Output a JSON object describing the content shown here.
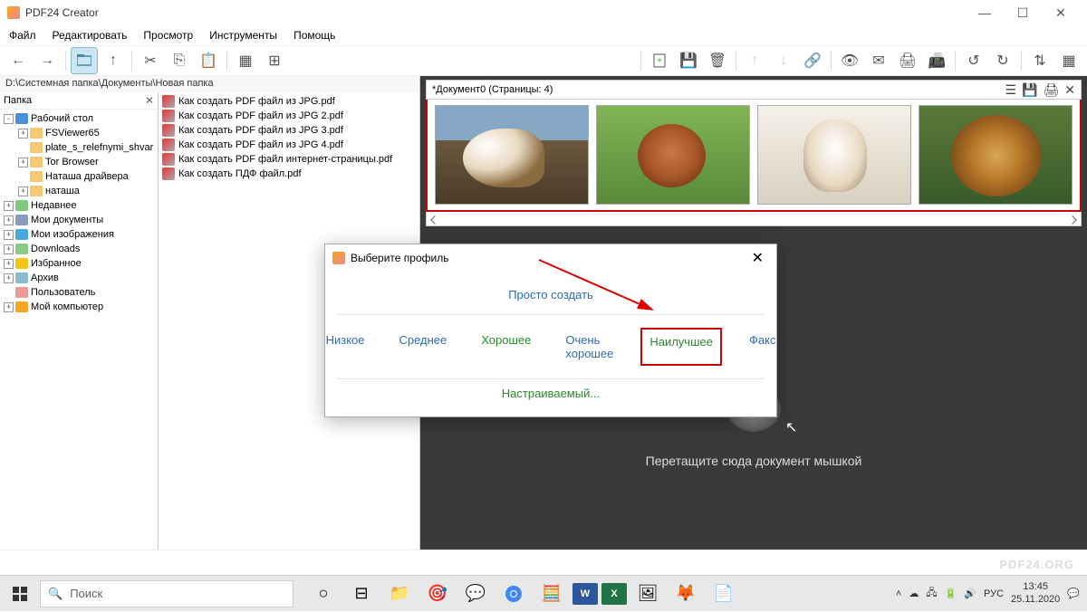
{
  "titlebar": {
    "app_name": "PDF24 Creator"
  },
  "menu": {
    "file": "Файл",
    "edit": "Редактировать",
    "view": "Просмотр",
    "tools": "Инструменты",
    "help": "Помощь"
  },
  "path": "D:\\Системная папка\\Документы\\Новая папка",
  "tree": {
    "header": "Папка",
    "items": [
      {
        "label": "Рабочий стол",
        "exp": "-",
        "ico": "desktop",
        "indent": 0
      },
      {
        "label": "FSViewer65",
        "exp": "+",
        "ico": "folder",
        "indent": 1
      },
      {
        "label": "plate_s_relefnymi_shvar",
        "exp": "",
        "ico": "folder",
        "indent": 1
      },
      {
        "label": "Tor Browser",
        "exp": "+",
        "ico": "folder",
        "indent": 1
      },
      {
        "label": "Наташа драйвера",
        "exp": "",
        "ico": "folder",
        "indent": 1
      },
      {
        "label": "наташа",
        "exp": "+",
        "ico": "folder",
        "indent": 1
      },
      {
        "label": "Недавнее",
        "exp": "+",
        "ico": "recent",
        "indent": 0
      },
      {
        "label": "Мои документы",
        "exp": "+",
        "ico": "docs",
        "indent": 0
      },
      {
        "label": "Мои изображения",
        "exp": "+",
        "ico": "pics",
        "indent": 0
      },
      {
        "label": "Downloads",
        "exp": "+",
        "ico": "dl",
        "indent": 0
      },
      {
        "label": "Избранное",
        "exp": "+",
        "ico": "star",
        "indent": 0
      },
      {
        "label": "Архив",
        "exp": "+",
        "ico": "archive",
        "indent": 0
      },
      {
        "label": "Пользователь",
        "exp": "",
        "ico": "user",
        "indent": 0
      },
      {
        "label": "Мой компьютер",
        "exp": "+",
        "ico": "pc",
        "indent": 0
      }
    ]
  },
  "files": [
    "Как создать PDF файл из JPG.pdf",
    "Как создать PDF файл из JPG 2.pdf",
    "Как создать PDF файл из JPG 3.pdf",
    "Как создать PDF файл из JPG 4.pdf",
    "Как создать PDF файл интернет-страницы.pdf",
    "Как создать ПДФ файл.pdf"
  ],
  "doc": {
    "title": "*Документ0 (Страницы: 4)"
  },
  "drop": {
    "hint": "Перетащите сюда документ мышкой"
  },
  "dialog": {
    "title": "Выберите профиль",
    "create": "Просто создать",
    "low": "Низкое",
    "med": "Среднее",
    "good": "Хорошее",
    "very": "Очень хорошее",
    "best": "Наилучшее",
    "fax": "Факс",
    "custom": "Настраиваемый..."
  },
  "watermark": "PDF24.ORG",
  "taskbar": {
    "search_placeholder": "Поиск",
    "lang": "РУС",
    "time": "13:45",
    "date": "25.11.2020"
  }
}
